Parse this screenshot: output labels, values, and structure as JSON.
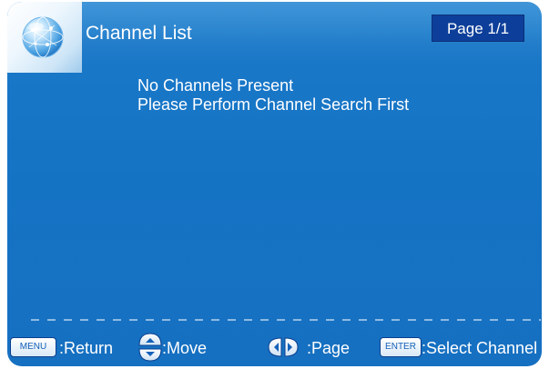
{
  "header": {
    "title": "Channel List",
    "page_indicator": "Page 1/1"
  },
  "main": {
    "message_line1": "No Channels Present",
    "message_line2": "Please Perform Channel Search First"
  },
  "footer": {
    "menu_key": "MENU",
    "menu_hint": ":Return",
    "move_hint": ":Move",
    "page_hint": ":Page",
    "enter_key": "ENTER",
    "enter_hint": ":Select Channel"
  },
  "colors": {
    "background": "#1573c4",
    "page_box": "#0d3f9a",
    "text": "#ffffff",
    "key_text": "#1360b8"
  },
  "icons": {
    "logo": "globe-icon",
    "move": "up-down-arrows-icon",
    "page": "left-right-arrows-icon"
  }
}
